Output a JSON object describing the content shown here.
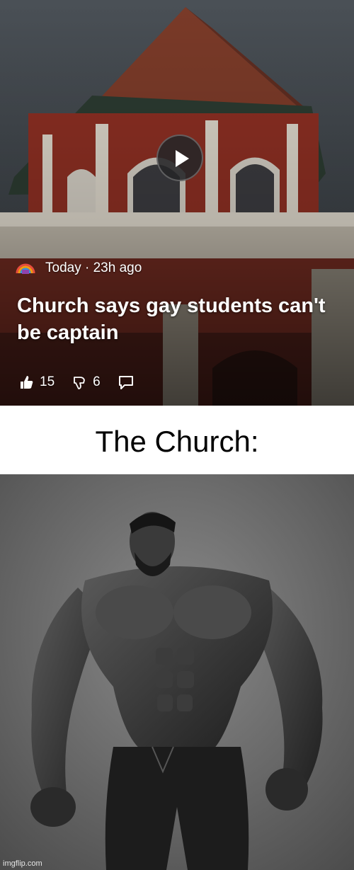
{
  "news_card": {
    "meta_text": "Today · 23h ago",
    "headline": "Church says gay students can't be captain",
    "likes": "15",
    "dislikes": "6",
    "icons": {
      "play": "play-icon",
      "source": "rainbow-logo-icon",
      "like": "thumbs-up-icon",
      "dislike": "thumbs-down-icon",
      "comment": "comment-icon"
    }
  },
  "caption": {
    "text": "The Church:"
  },
  "image": {
    "watermark": "imgflip.com"
  },
  "colors": {
    "sky": "#3b4046",
    "brick": "#8a2e22",
    "roof": "#7a3a28",
    "white": "#ffffff",
    "caption_bg": "#ffffff"
  }
}
